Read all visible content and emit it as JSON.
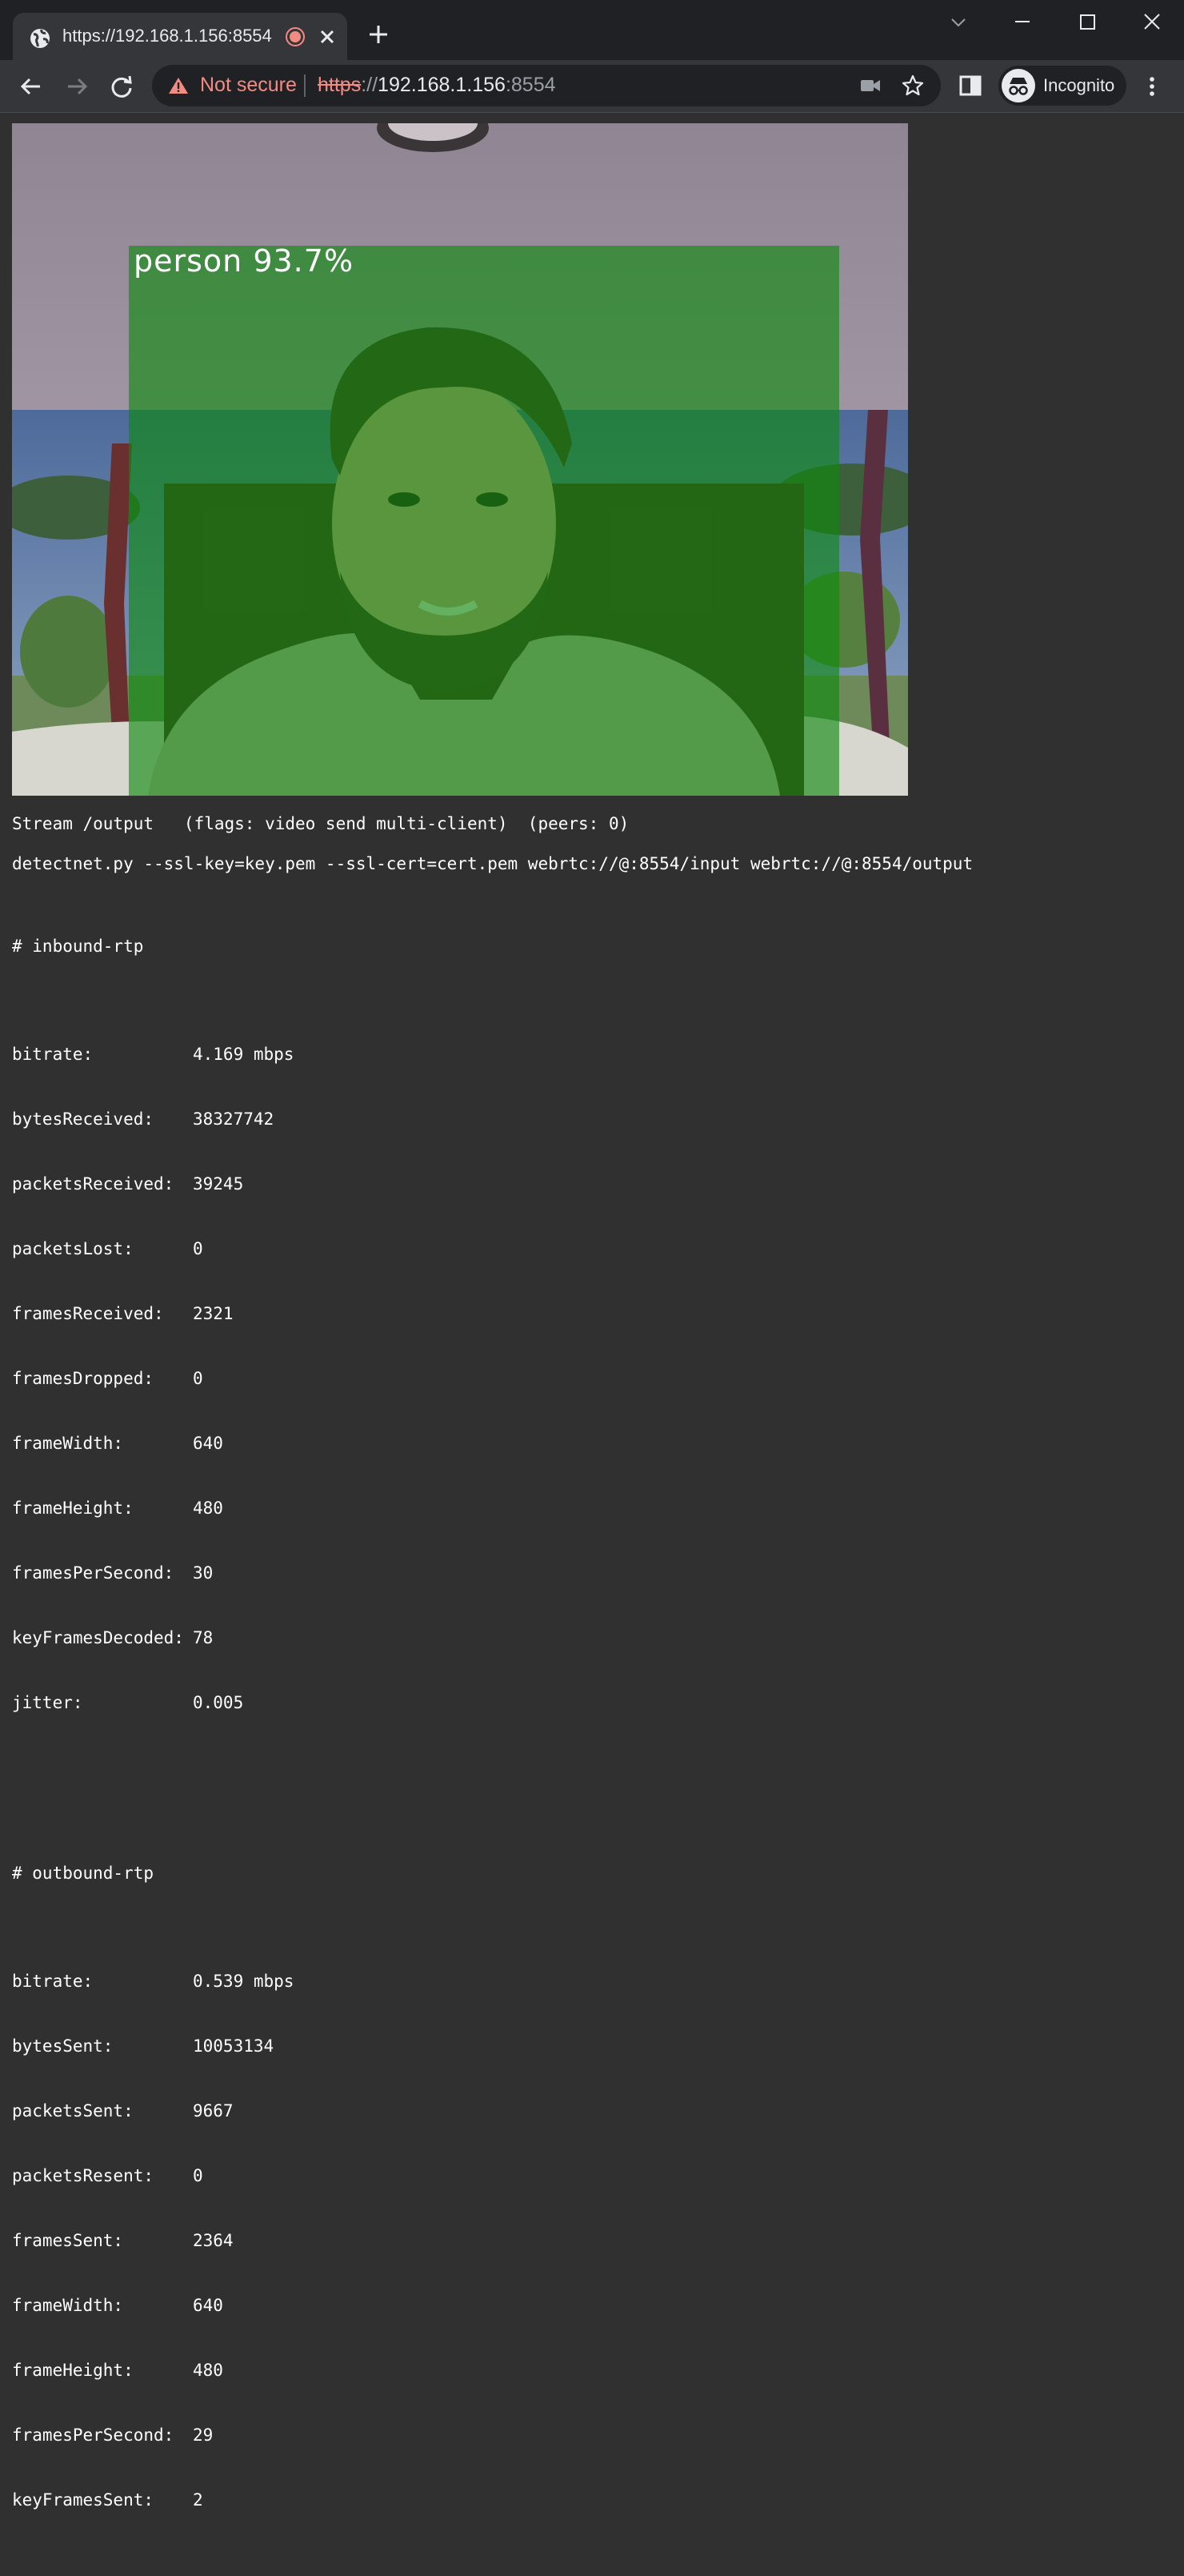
{
  "browser": {
    "tab_title": "https://192.168.1.156:8554",
    "security_label": "Not secure",
    "url_scheme": "https",
    "url_slashes": "://",
    "url_host": "192.168.1.156",
    "url_port": ":8554",
    "profile_label": "Incognito"
  },
  "video": {
    "detection_label": "person 93.7%",
    "overlay_color": "#2e9a2e"
  },
  "stream": {
    "status_line": "Stream /output   (flags: video send multi-client)  (peers: 0)",
    "command_line": "detectnet.py --ssl-key=key.pem --ssl-cert=cert.pem webrtc://@:8554/input webrtc://@:8554/output"
  },
  "inbound": {
    "header": "# inbound-rtp",
    "rows": [
      {
        "key": "bitrate:",
        "value": "4.169 mbps"
      },
      {
        "key": "bytesReceived:",
        "value": "38327742"
      },
      {
        "key": "packetsReceived:",
        "value": "39245"
      },
      {
        "key": "packetsLost:",
        "value": "0"
      },
      {
        "key": "framesReceived:",
        "value": "2321"
      },
      {
        "key": "framesDropped:",
        "value": "0"
      },
      {
        "key": "frameWidth:",
        "value": "640"
      },
      {
        "key": "frameHeight:",
        "value": "480"
      },
      {
        "key": "framesPerSecond:",
        "value": "30"
      },
      {
        "key": "keyFramesDecoded:",
        "value": "78"
      },
      {
        "key": "jitter:",
        "value": "0.005"
      }
    ]
  },
  "outbound": {
    "header": "# outbound-rtp",
    "rows": [
      {
        "key": "bitrate:",
        "value": "0.539 mbps"
      },
      {
        "key": "bytesSent:",
        "value": "10053134"
      },
      {
        "key": "packetsSent:",
        "value": "9667"
      },
      {
        "key": "packetsResent:",
        "value": "0"
      },
      {
        "key": "framesSent:",
        "value": "2364"
      },
      {
        "key": "frameWidth:",
        "value": "640"
      },
      {
        "key": "frameHeight:",
        "value": "480"
      },
      {
        "key": "framesPerSecond:",
        "value": "29"
      },
      {
        "key": "keyFramesSent:",
        "value": "2"
      }
    ]
  }
}
